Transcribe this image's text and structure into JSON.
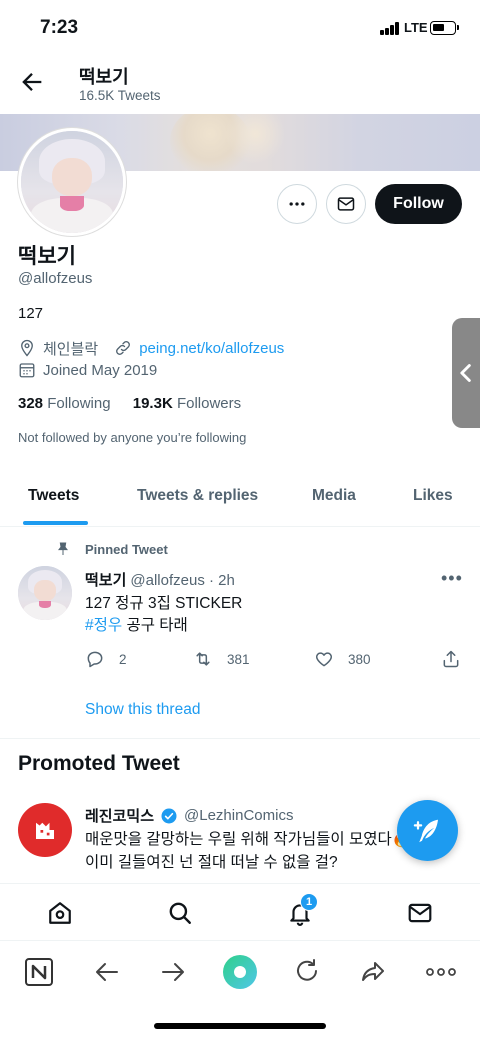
{
  "status_bar": {
    "time": "7:23",
    "network": "LTE"
  },
  "header": {
    "title": "떡보기",
    "subtitle": "16.5K Tweets"
  },
  "profile": {
    "name": "떡보기",
    "handle": "@allofzeus",
    "bio": "127",
    "location": "체인블락",
    "website": "peing.net/ko/allofzeus",
    "joined": "Joined May 2019",
    "following_count": "328",
    "following_label": "Following",
    "followers_count": "19.3K",
    "followers_label": "Followers",
    "not_followed_note": "Not followed by anyone you’re following",
    "follow_label": "Follow"
  },
  "tabs": [
    "Tweets",
    "Tweets & replies",
    "Media",
    "Likes"
  ],
  "active_tab": "Tweets",
  "pinned_tweet": {
    "pinned_label": "Pinned Tweet",
    "author_name": "떡보기",
    "author_handle": "@allofzeus · 2h",
    "line1": "127 정규 3집 STICKER",
    "hashtag": "#정우",
    "line2_rest": " 공구 타래",
    "replies": "2",
    "retweets": "381",
    "likes": "380",
    "show_thread": "Show this thread"
  },
  "promoted": {
    "section_title": "Promoted Tweet",
    "author_name": "레진코믹스",
    "author_handle": "@LezhinComics",
    "line1": "매운맛을 갈망하는 우릴 위해 작가님들이 모였다🔥",
    "line2": "이미 길들여진 넌 절대 떠날 수 없을 걸?"
  },
  "notifications_badge": "1",
  "colors": {
    "accent": "#1d9bf0",
    "text": "#0f1419",
    "muted": "#536471",
    "brand_red": "#e02b2b"
  }
}
